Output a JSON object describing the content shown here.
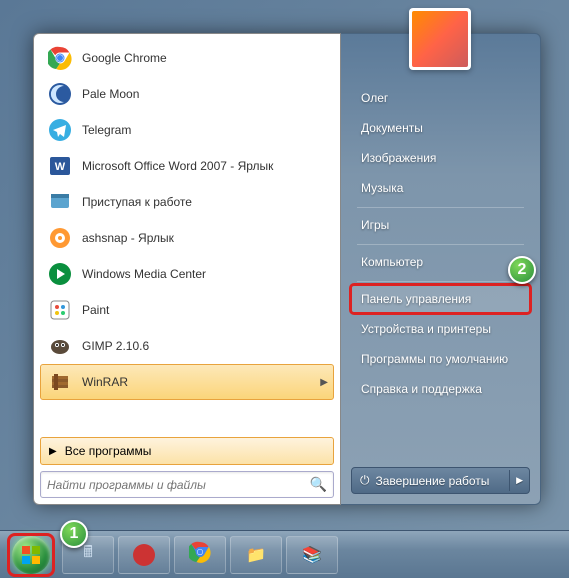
{
  "left": {
    "apps": [
      {
        "name": "Google Chrome",
        "icon_bg": "#fff"
      },
      {
        "name": "Pale Moon",
        "icon_bg": "#fff"
      },
      {
        "name": "Telegram",
        "icon_bg": "#fff"
      },
      {
        "name": "Microsoft Office Word 2007 - Ярлык",
        "icon_bg": "#fff"
      },
      {
        "name": "Приступая к работе",
        "icon_bg": "#fff"
      },
      {
        "name": "ashsnap - Ярлык",
        "icon_bg": "#fff"
      },
      {
        "name": "Windows Media Center",
        "icon_bg": "#fff"
      },
      {
        "name": "Paint",
        "icon_bg": "#fff"
      },
      {
        "name": "GIMP 2.10.6",
        "icon_bg": "#fff"
      },
      {
        "name": "WinRAR",
        "icon_bg": "#fff",
        "highlighted": true,
        "flyout": true
      }
    ],
    "all_programs": "Все программы",
    "search_placeholder": "Найти программы и файлы"
  },
  "right": {
    "user": "Олег",
    "items": [
      {
        "label": "Олег"
      },
      {
        "label": "Документы"
      },
      {
        "label": "Изображения"
      },
      {
        "label": "Музыка"
      },
      {
        "sep": true
      },
      {
        "label": "Игры"
      },
      {
        "sep": true
      },
      {
        "label": "Компьютер"
      },
      {
        "sep": true
      },
      {
        "label": "Панель управления",
        "selected": true
      },
      {
        "label": "Устройства и принтеры"
      },
      {
        "label": "Программы по умолчанию"
      },
      {
        "label": "Справка и поддержка"
      }
    ],
    "shutdown": "Завершение работы"
  },
  "callouts": {
    "c1": "1",
    "c2": "2"
  }
}
